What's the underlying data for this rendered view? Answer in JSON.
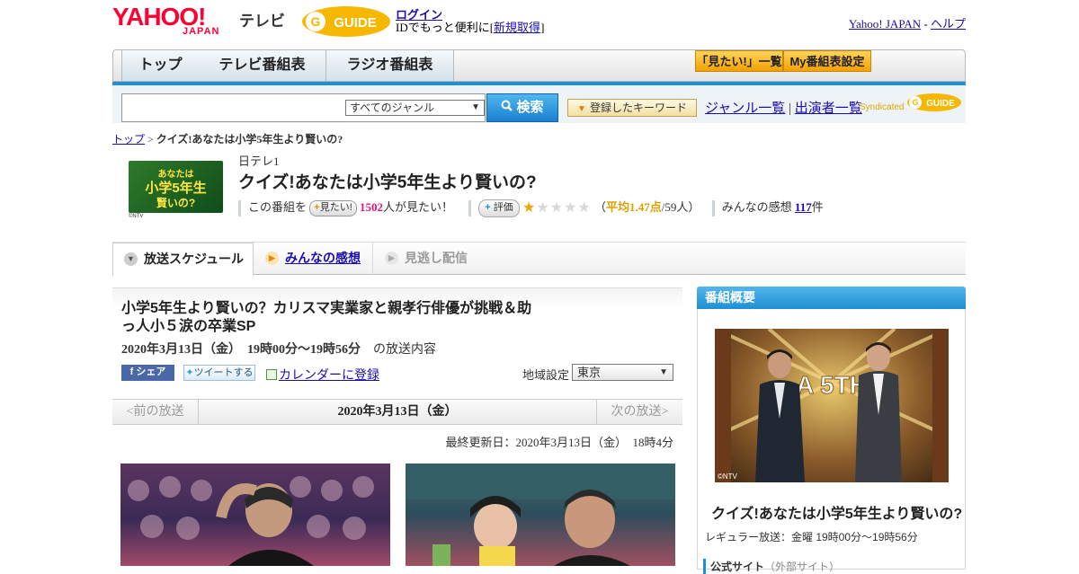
{
  "header": {
    "logo_yahoo": "YAHOO!",
    "logo_japan": "JAPAN",
    "logo_tv": "テレビ",
    "gguide_logo": "G GUIDE",
    "login_link": "ログイン",
    "id_text_prefix": "IDでもっと便利に[",
    "signup_link": "新規取得",
    "id_text_suffix": "]",
    "yahoo_japan_link": "Yahoo! JAPAN",
    "separator": "-",
    "help_link": "ヘルプ"
  },
  "nav": {
    "tabs": [
      "トップ",
      "テレビ番組表",
      "ラジオ番組表"
    ],
    "mitai_list": "「見たい!」一覧",
    "my_schedule": "My番組表設定"
  },
  "search": {
    "genre_selected": "すべてのジャンル",
    "search_button": "検索",
    "keyword_button": "登録したキーワード",
    "genre_list_link": "ジャンル一覧",
    "divider": "|",
    "performer_list_link": "出演者一覧",
    "syndicated": "Syndicated"
  },
  "breadcrumb": {
    "top_link": "トップ",
    "sep": ">",
    "current": "クイズ!あなたは小学5年生より賢いの?"
  },
  "program": {
    "thumb_text_line1": "あなたは",
    "thumb_text_line2": "小学5年生",
    "thumb_text_line3": "賢いの?",
    "thumb_credit": "©NTV",
    "channel": "日テレ1",
    "title": "クイズ!あなたは小学5年生より賢いの?",
    "want_prefix": "この番組を",
    "want_button": "見たい!",
    "want_count": "1502",
    "want_suffix": "人が見たい！",
    "rating_button": "評価",
    "stars_on": "★",
    "stars_off": "★★★★",
    "rating_open": "（",
    "rating_avg": "平均1.47点",
    "rating_people": "/59人）",
    "reviews_prefix": "みんなの感想",
    "reviews_count": "117",
    "reviews_suffix": "件"
  },
  "tabs": {
    "schedule": "放送スケジュール",
    "reviews": "みんなの感想",
    "streaming": "見逃し配信"
  },
  "episode": {
    "title": "小学5年生より賢いの？カリスマ実業家と親孝行俳優が挑戦＆助っ人小５涙の卒業SP",
    "date": "2020年3月13日（金）　19時00分～19時56分",
    "date_suffix": "の放送内容",
    "facebook_share": "シェア",
    "tweet": "ツイートする",
    "calendar_link": "カレンダーに登録",
    "region_label": "地域設定",
    "region_value": "東京",
    "prev": "<前の放送",
    "current_date": "2020年3月13日（金）",
    "next": "次の放送>",
    "updated": "最終更新日：2020年3月13日（金）　18時4分"
  },
  "sidebar": {
    "header": "番組概要",
    "photo_text": "A 5TH",
    "photo_credit": "©NTV",
    "title": "クイズ!あなたは小学5年生より賢いの?",
    "regular": "レギュラー放送：金曜 19時00分～19時56分",
    "official_site": "公式サイト",
    "official_note": "（外部サイト）"
  },
  "colors": {
    "brand_red": "#ff0033",
    "accent_blue": "#1e90d8",
    "orange": "#f2a100",
    "pink": "#e0137a"
  }
}
